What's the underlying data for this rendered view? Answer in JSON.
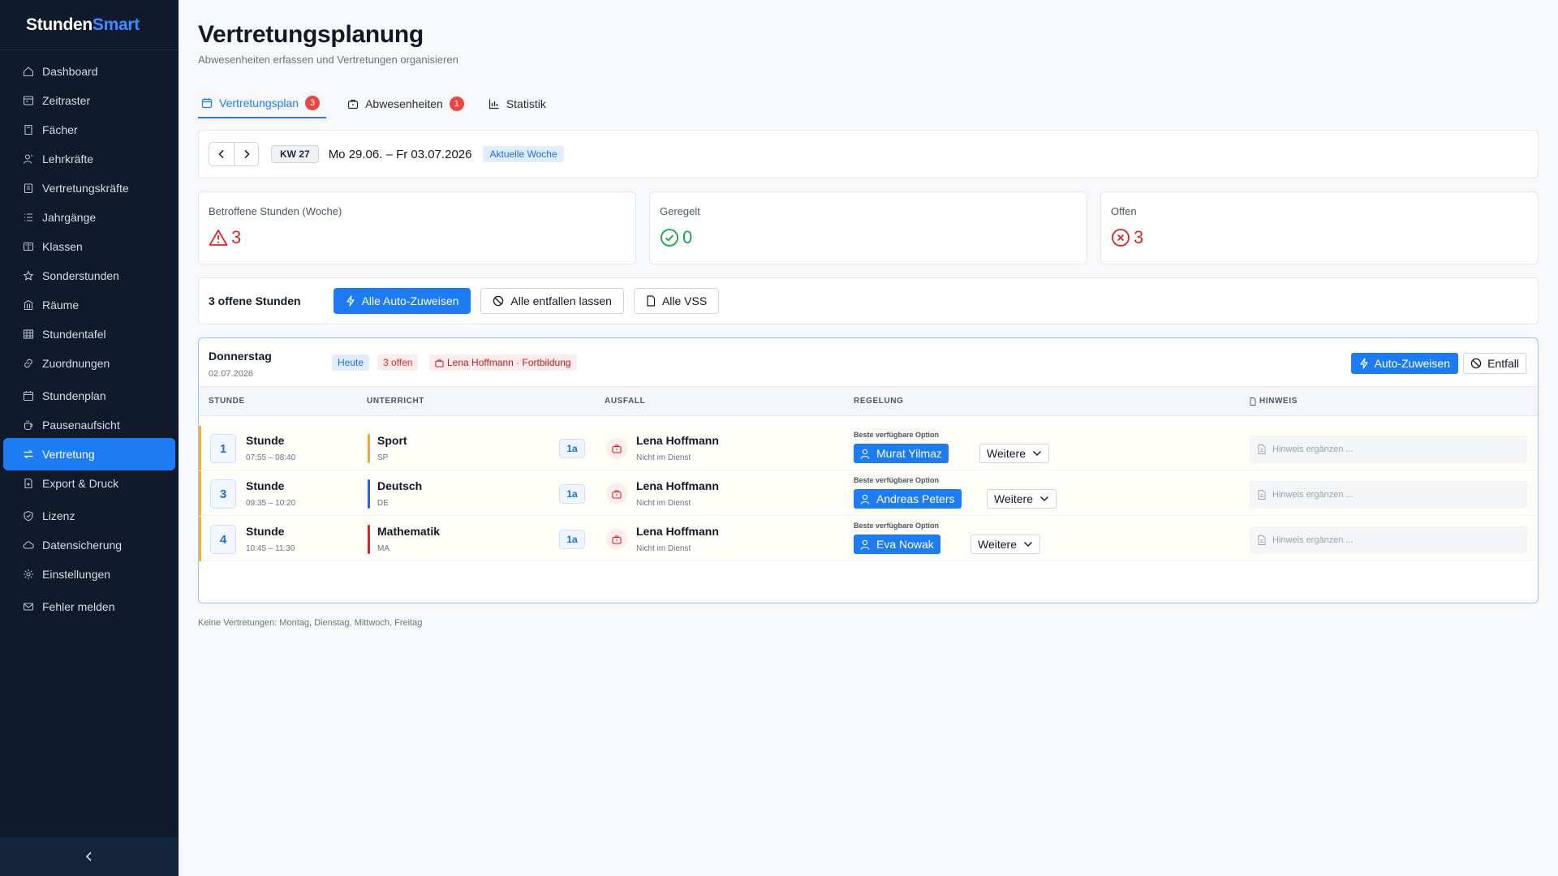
{
  "app": {
    "brand_part1": "Stunden",
    "brand_part2": "Smart"
  },
  "sidebar": {
    "items": [
      {
        "label": "Dashboard",
        "icon": "home-icon"
      },
      {
        "label": "Zeitraster",
        "icon": "clock-grid-icon"
      },
      {
        "label": "Fächer",
        "icon": "book-icon"
      },
      {
        "label": "Lehrkräfte",
        "icon": "teacher-icon"
      },
      {
        "label": "Vertretungskräfte",
        "icon": "clipboard-icon"
      },
      {
        "label": "Jahrgänge",
        "icon": "list-icon"
      },
      {
        "label": "Klassen",
        "icon": "classroom-icon"
      },
      {
        "label": "Sonderstunden",
        "icon": "star-icon"
      },
      {
        "label": "Räume",
        "icon": "building-icon"
      },
      {
        "label": "Stundentafel",
        "icon": "table-icon"
      },
      {
        "label": "Zuordnungen",
        "icon": "link-icon"
      },
      {
        "label": "Stundenplan",
        "icon": "calendar-icon"
      },
      {
        "label": "Pausenaufsicht",
        "icon": "coffee-icon"
      },
      {
        "label": "Vertretung",
        "icon": "swap-icon",
        "active": true
      },
      {
        "label": "Export & Druck",
        "icon": "export-icon"
      },
      {
        "label": "Lizenz",
        "icon": "shield-icon"
      },
      {
        "label": "Datensicherung",
        "icon": "cloud-icon"
      },
      {
        "label": "Einstellungen",
        "icon": "gear-icon"
      },
      {
        "label": "Fehler melden",
        "icon": "mail-icon"
      }
    ]
  },
  "page": {
    "title": "Vertretungsplanung",
    "subtitle": "Abwesenheiten erfassen und Vertretungen organisieren"
  },
  "tabs": [
    {
      "label": "Vertretungsplan",
      "badge": "3",
      "icon": "calendar-icon",
      "active": true
    },
    {
      "label": "Abwesenheiten",
      "badge": "1",
      "icon": "suitcase-icon"
    },
    {
      "label": "Statistik",
      "icon": "bar-chart-icon"
    }
  ],
  "week": {
    "kw": "KW 27",
    "range": "Mo 29.06. – Fr 03.07.2026",
    "current_label": "Aktuelle Woche"
  },
  "stats": [
    {
      "label": "Betroffene Stunden (Woche)",
      "value": "3",
      "color": "#dc2626",
      "icon": "warning-icon"
    },
    {
      "label": "Geregelt",
      "value": "0",
      "color": "#16a34a",
      "icon": "check-circle-icon"
    },
    {
      "label": "Offen",
      "value": "3",
      "color": "#dc2626",
      "icon": "x-circle-icon"
    }
  ],
  "actions": {
    "open_count": "3 offene Stunden",
    "auto_assign_all": "Alle Auto-Zuweisen",
    "cancel_all": "Alle entfallen lassen",
    "all_vss": "Alle VSS"
  },
  "day": {
    "name": "Donnerstag",
    "date": "02.07.2026",
    "tag_today": "Heute",
    "tag_open": "3 offen",
    "tag_absent": "Lena Hoffmann · Fortbildung",
    "auto_assign": "Auto-Zuweisen",
    "entfall": "Entfall",
    "columns": [
      "STUNDE",
      "UNTERRICHT",
      "AUSFALL",
      "REGELUNG",
      "HINWEIS"
    ],
    "rows": [
      {
        "number": "1",
        "stunde_label": "Stunde",
        "time": "07:55 – 08:40",
        "subject": "Sport",
        "subject_code": "SP",
        "subject_color": "#f2a93b",
        "class": "1a",
        "absent_name": "Lena Hoffmann",
        "absent_status": "Nicht im Dienst",
        "best_label": "Beste verfügbare Option",
        "assignee": "Murat Yilmaz",
        "more_label": "Weitere",
        "hint_placeholder": "Hinweis ergänzen ..."
      },
      {
        "number": "3",
        "stunde_label": "Stunde",
        "time": "09:35 – 10:20",
        "subject": "Deutsch",
        "subject_code": "DE",
        "subject_color": "#2563eb",
        "class": "1a",
        "absent_name": "Lena Hoffmann",
        "absent_status": "Nicht im Dienst",
        "best_label": "Beste verfügbare Option",
        "assignee": "Andreas Peters",
        "more_label": "Weitere",
        "hint_placeholder": "Hinweis ergänzen ..."
      },
      {
        "number": "4",
        "stunde_label": "Stunde",
        "time": "10:45 – 11:30",
        "subject": "Mathematik",
        "subject_code": "MA",
        "subject_color": "#dc2626",
        "class": "1a",
        "absent_name": "Lena Hoffmann",
        "absent_status": "Nicht im Dienst",
        "best_label": "Beste verfügbare Option",
        "assignee": "Eva Nowak",
        "more_label": "Weitere",
        "hint_placeholder": "Hinweis ergänzen ..."
      }
    ]
  },
  "footer_note": "Keine Vertretungen: Montag, Dienstag, Mittwoch, Freitag"
}
